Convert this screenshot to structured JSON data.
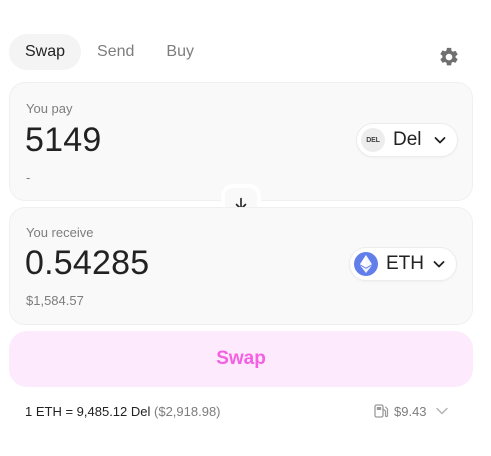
{
  "tabs": [
    {
      "label": "Swap",
      "active": true
    },
    {
      "label": "Send",
      "active": false
    },
    {
      "label": "Buy",
      "active": false
    }
  ],
  "pay": {
    "label": "You pay",
    "amount": "5149",
    "fiat": "-",
    "token": {
      "symbol": "Del",
      "logo_text": "DEL",
      "icon": "del-token-icon"
    }
  },
  "receive": {
    "label": "You receive",
    "amount": "0.54285",
    "fiat": "$1,584.57",
    "token": {
      "symbol": "ETH",
      "icon": "eth-token-icon"
    }
  },
  "swap_button": {
    "label": "Swap"
  },
  "rate": {
    "text": "1 ETH = 9,485.12 Del",
    "usd": "($2,918.98)"
  },
  "gas": {
    "value": "$9.43",
    "icon": "gas-pump-icon"
  },
  "colors": {
    "accent_pink": "#f45fe3",
    "button_bg": "#fdeafd",
    "card_bg": "#f9f9f9",
    "eth_blue": "#627eea",
    "muted_text": "#7d7d7d"
  }
}
